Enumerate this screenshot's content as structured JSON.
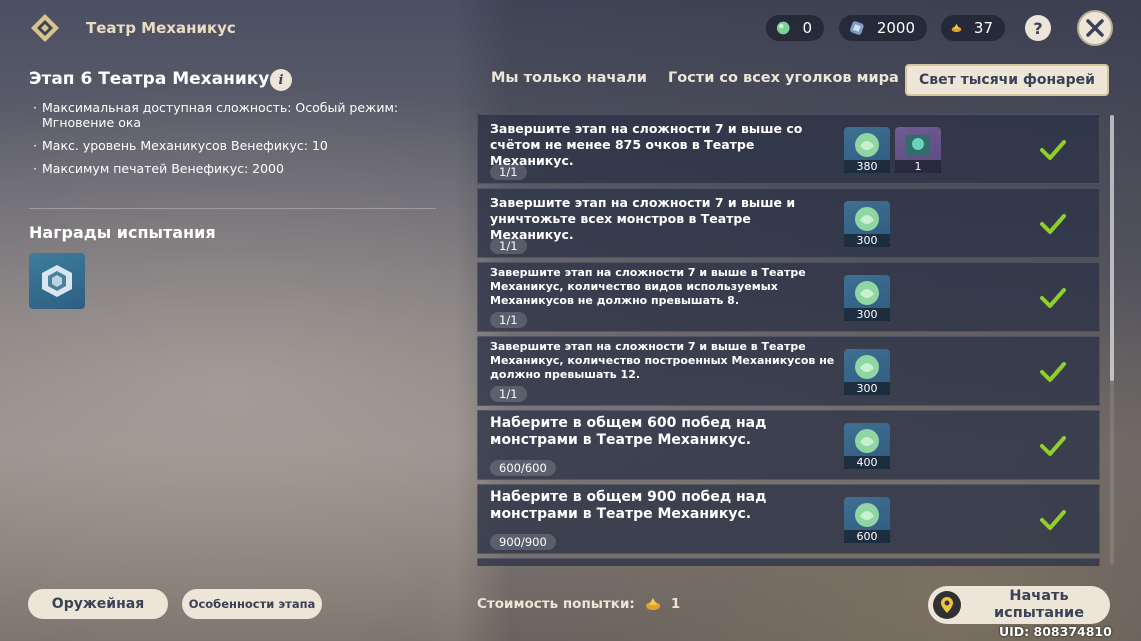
{
  "header": {
    "app_title": "Театр Механикус",
    "currencies": [
      {
        "icon": "green-gem-icon",
        "value": "0"
      },
      {
        "icon": "mora-crystal-icon",
        "value": "2000"
      },
      {
        "icon": "fragile-resin-icon",
        "value": "37"
      }
    ],
    "help_label": "?"
  },
  "stage": {
    "title": "Этап 6 Театра Механикус",
    "info_label": "i",
    "info": [
      "Максимальная доступная сложность: Особый режим: Мгновение ока",
      "Макс. уровень Механикусов Венефикус: 10",
      "Максимум печатей Венефикус: 2000"
    ]
  },
  "rewards": {
    "title": "Награды испытания",
    "items": [
      {
        "icon": "crystal-cube-icon"
      }
    ]
  },
  "left_buttons": {
    "armory": "Оружейная",
    "features": "Особенности этапа"
  },
  "tabs": [
    {
      "label": "Мы только начали",
      "active": false
    },
    {
      "label": "Гости со всех уголков мира",
      "active": false
    },
    {
      "label": "Свет тысячи фонарей",
      "active": true
    }
  ],
  "tasks": [
    {
      "description": "Завершите этап на сложности 7 и выше со счётом не менее 875 очков в Театре Механикус.",
      "progress": "1/1",
      "rewards": [
        {
          "icon": "green-gem-icon",
          "qty": "380"
        },
        {
          "icon": "namecard-icon",
          "qty": "1"
        }
      ],
      "completed": true
    },
    {
      "description": "Завершите этап на сложности 7 и выше и уничтожьте всех монстров в Театре Механикус.",
      "progress": "1/1",
      "rewards": [
        {
          "icon": "green-gem-icon",
          "qty": "300"
        }
      ],
      "completed": true
    },
    {
      "description": "Завершите этап на сложности 7 и выше в Театре Механикус, количество видов используемых Механикусов не должно превышать 8.",
      "progress": "1/1",
      "rewards": [
        {
          "icon": "green-gem-icon",
          "qty": "300"
        }
      ],
      "completed": true
    },
    {
      "description": "Завершите этап на сложности 7 и выше в Театре Механикус, количество построенных Механикусов не должно превышать 12.",
      "progress": "1/1",
      "rewards": [
        {
          "icon": "green-gem-icon",
          "qty": "300"
        }
      ],
      "completed": true
    },
    {
      "description": "Наберите в общем 600 побед над монстрами в Театре Механикус.",
      "progress": "600/600",
      "rewards": [
        {
          "icon": "green-gem-icon",
          "qty": "400"
        }
      ],
      "completed": true
    },
    {
      "description": "Наберите в общем 900 побед над монстрами в Театре Механикус.",
      "progress": "900/900",
      "rewards": [
        {
          "icon": "green-gem-icon",
          "qty": "600"
        }
      ],
      "completed": true
    }
  ],
  "footer": {
    "cost_label": "Стоимость попытки:",
    "cost_icon": "fragile-resin-icon",
    "cost_value": "1",
    "start_label": "Начать испытание",
    "uid": "UID: 808374810"
  },
  "colors": {
    "accent": "#ece5d8",
    "panel": "#2c3246",
    "check": "#8fcf2c",
    "text_dark": "#3b4255"
  }
}
